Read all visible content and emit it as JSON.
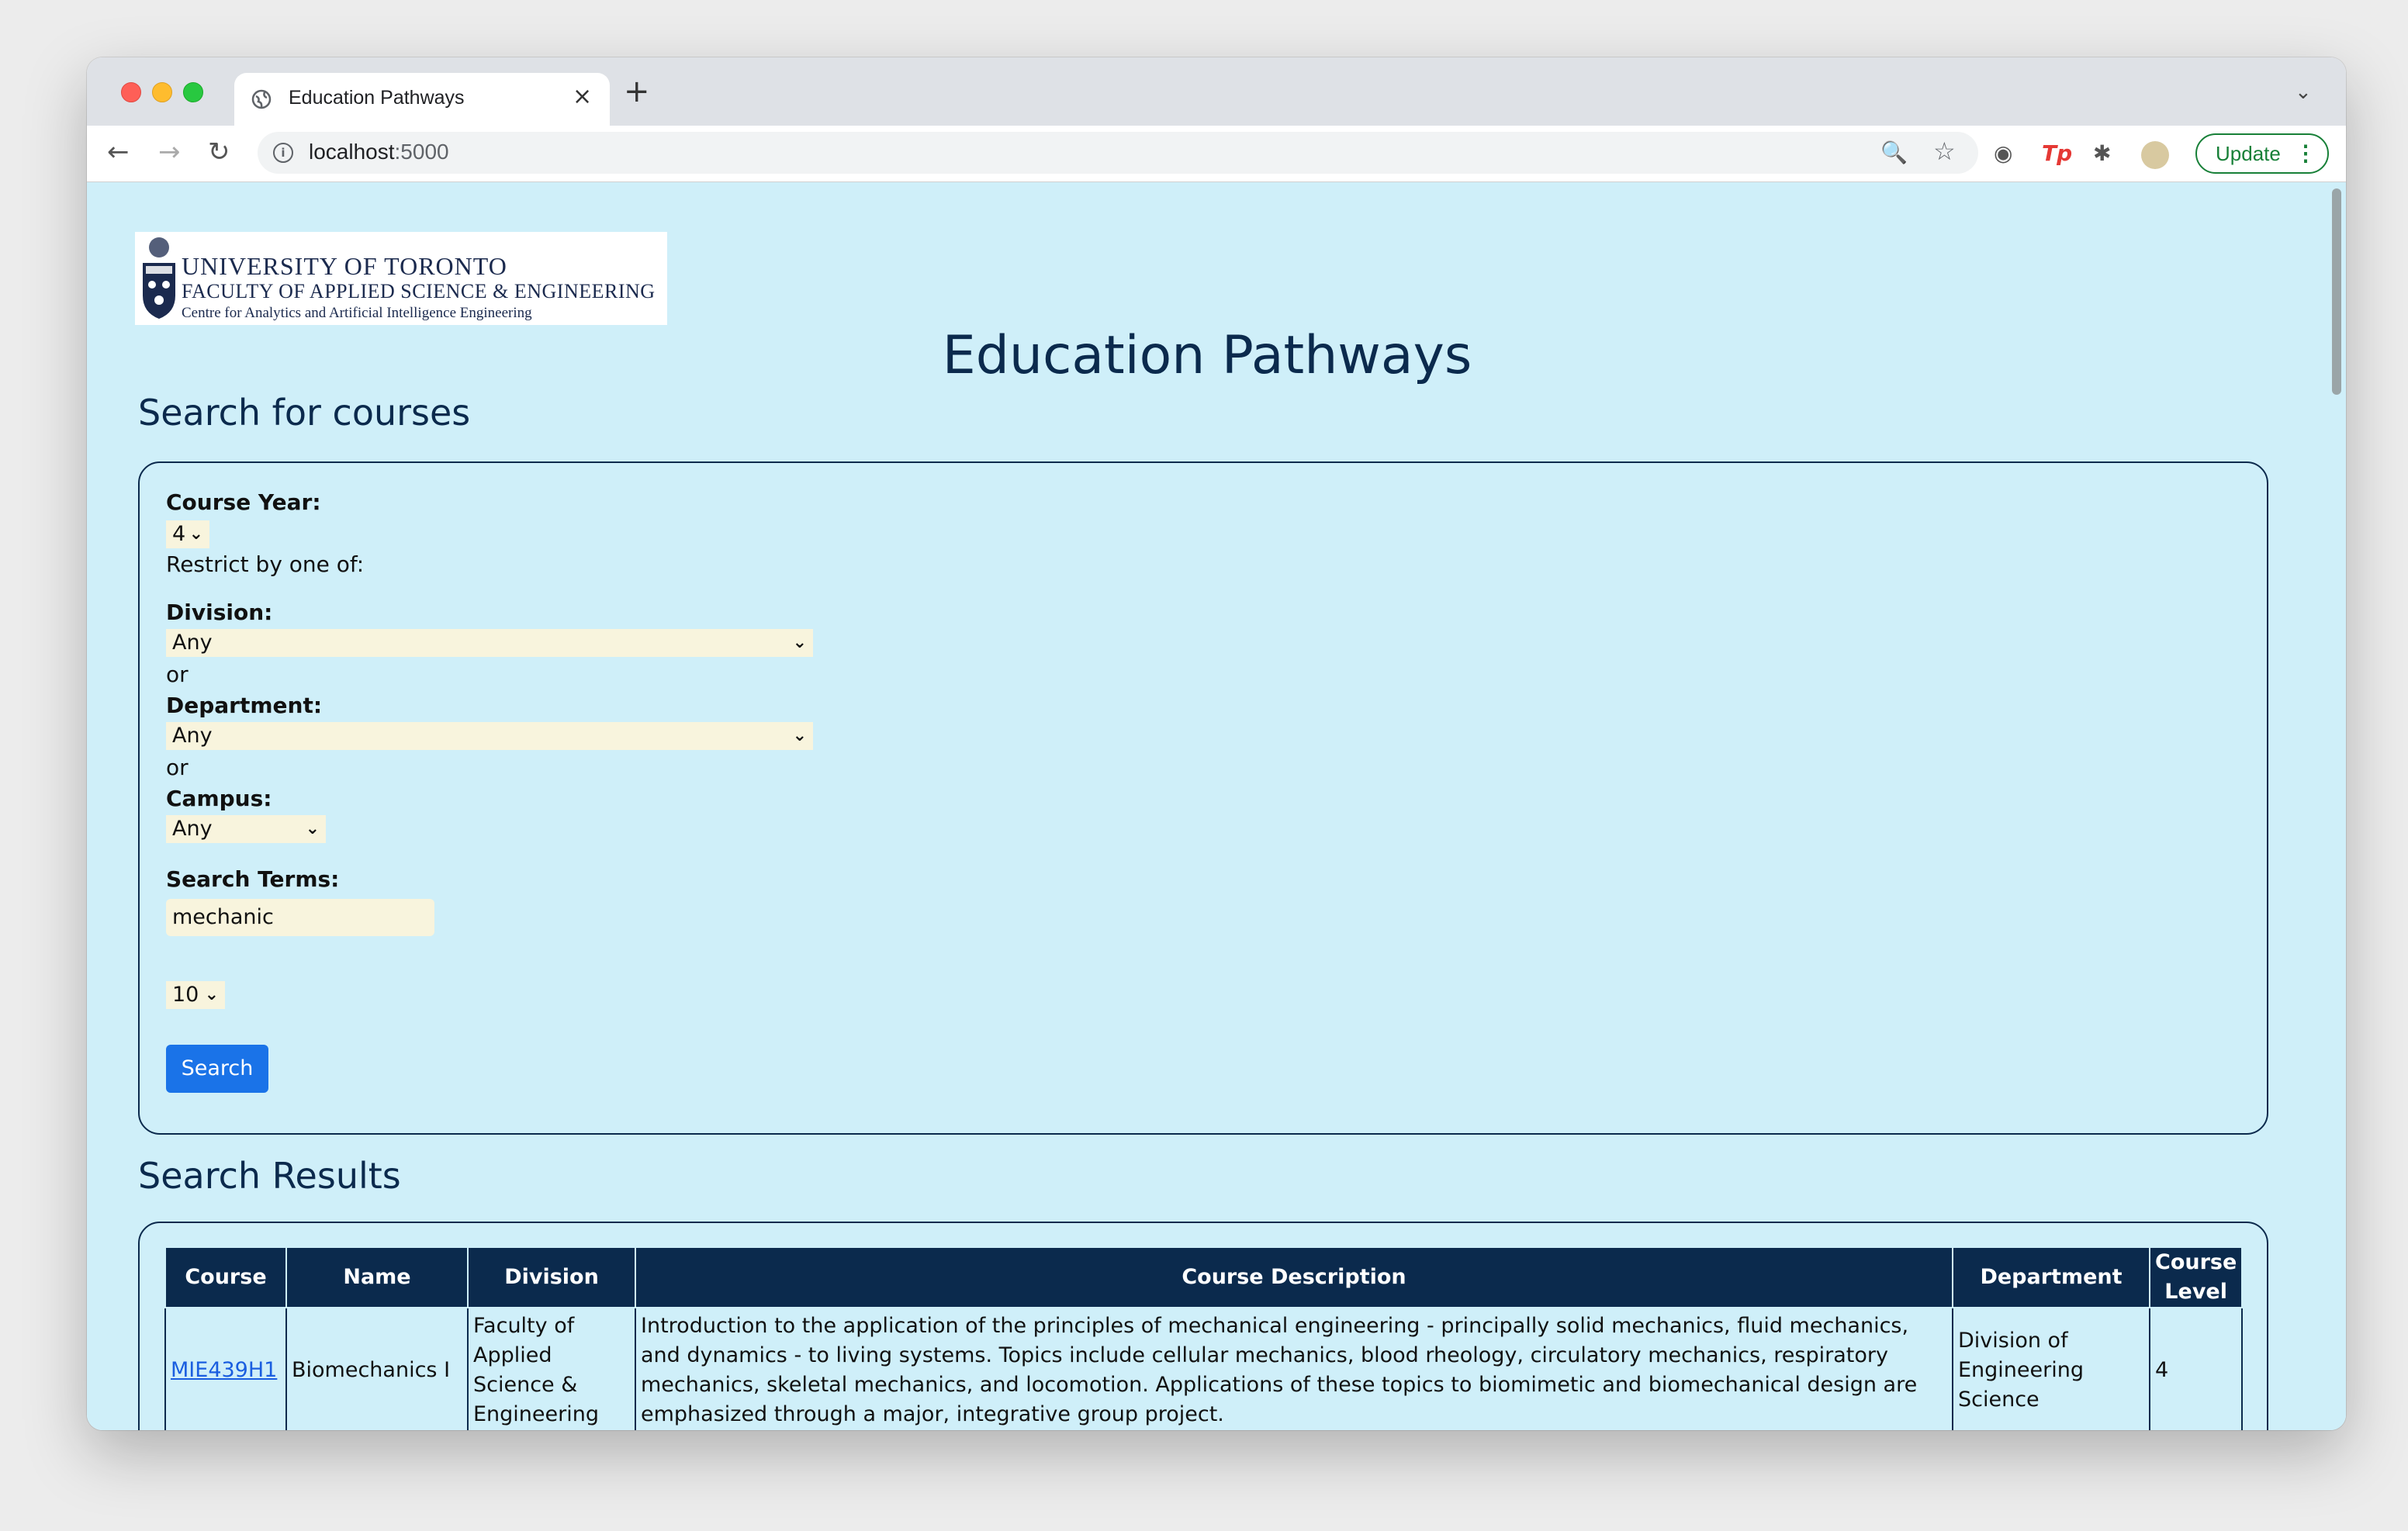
{
  "browser": {
    "tab_title": "Education Pathways",
    "url_host": "localhost",
    "url_port": ":5000",
    "update_label": "Update",
    "close_tab_symbol": "×",
    "new_tab_symbol": "+",
    "back_symbol": "←",
    "forward_symbol": "→",
    "reload_symbol": "↻",
    "zoom_symbol": "🔍",
    "bookmark_symbol": "☆",
    "tab_menu_symbol": "⌄",
    "menu_symbol": "⋮",
    "extensions": {
      "ext1_symbol": "◉",
      "tp_label": "Tp",
      "puzzle_symbol": "✱"
    }
  },
  "logo": {
    "line1": "UNIVERSITY OF TORONTO",
    "line2": "FACULTY OF APPLIED SCIENCE & ENGINEERING",
    "line3": "Centre for Analytics and Artificial Intelligence Engineering"
  },
  "page": {
    "title": "Education Pathways",
    "search_heading": "Search for courses",
    "results_heading": "Search Results"
  },
  "form": {
    "course_year_label": "Course Year:",
    "course_year_value": "4",
    "restrict_text": "Restrict by one of:",
    "division_label": "Division:",
    "division_value": "Any",
    "or_1": "or",
    "department_label": "Department:",
    "department_value": "Any",
    "or_2": "or",
    "campus_label": "Campus:",
    "campus_value": "Any",
    "search_terms_label": "Search Terms:",
    "search_terms_value": "mechanic",
    "results_count_value": "10",
    "search_button": "Search"
  },
  "results": {
    "headers": {
      "course": "Course",
      "name": "Name",
      "division": "Division",
      "description": "Course Description",
      "department": "Department",
      "level_line1": "Course",
      "level_line2": "Level"
    },
    "rows": [
      {
        "course": "MIE439H1",
        "name": "Biomechanics I",
        "division": "Faculty of Applied Science & Engineering",
        "description": "Introduction to the application of the principles of mechanical engineering - principally solid mechanics, fluid mechanics, and dynamics - to living systems. Topics include cellular mechanics, blood rheology, circulatory mechanics, respiratory mechanics, skeletal mechanics, and locomotion. Applications of these topics to biomimetic and biomechanical design are emphasized through a major, integrative group project.",
        "department": "Division of Engineering Science",
        "level": "4"
      }
    ]
  }
}
